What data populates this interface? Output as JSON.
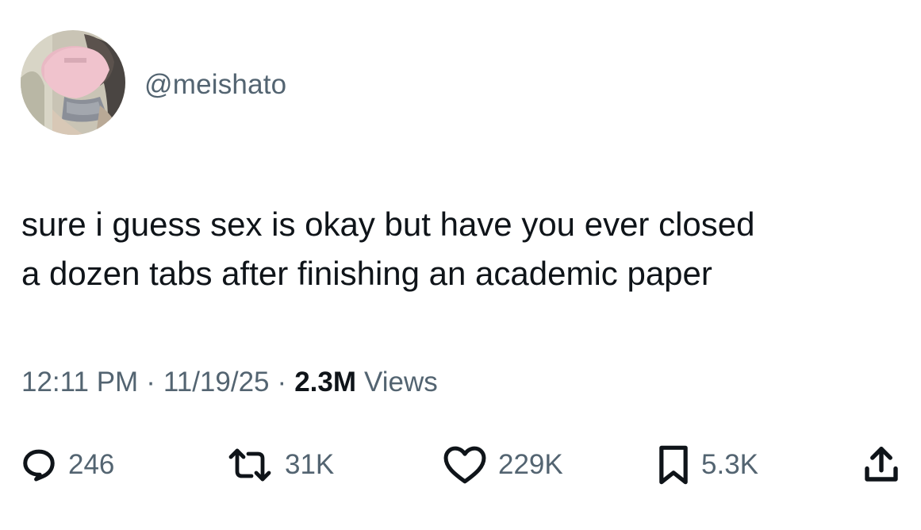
{
  "author": {
    "handle": "@meishato",
    "avatar": "profile-photo"
  },
  "tweet": {
    "text_lines": [
      "sure i guess sex is okay but have you ever closed",
      "a dozen tabs after finishing an academic paper"
    ]
  },
  "meta": {
    "time": "12:11 PM",
    "separator": "·",
    "date": "11/19/25",
    "views_count": "2.3M",
    "views_label": "Views"
  },
  "actions": {
    "replies": {
      "icon": "reply-icon",
      "count": "246"
    },
    "reposts": {
      "icon": "repost-icon",
      "count": "31K"
    },
    "likes": {
      "icon": "heart-icon",
      "count": "229K"
    },
    "bookmarks": {
      "icon": "bookmark-icon",
      "count": "5.3K"
    },
    "share": {
      "icon": "share-icon"
    }
  },
  "colors": {
    "text_primary": "#0f1419",
    "text_secondary": "#536471",
    "background": "#ffffff"
  }
}
